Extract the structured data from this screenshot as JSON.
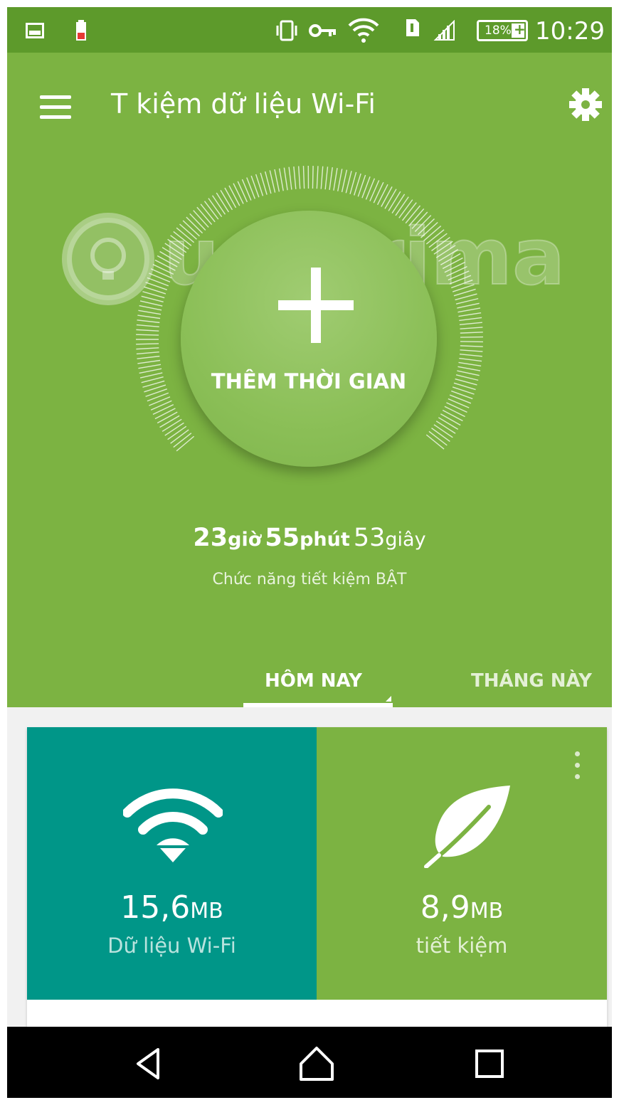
{
  "status_bar": {
    "time": "10:29",
    "battery_percent": "18%",
    "icons": [
      "gallery-icon",
      "battery-low-icon",
      "vibrate-icon",
      "key-icon",
      "wifi-icon",
      "sim-icon",
      "signal-icon"
    ]
  },
  "app_bar": {
    "title": "T kiệm dữ liệu Wi-Fi",
    "menu_icon": "menu-icon",
    "settings_icon": "gear-icon"
  },
  "hero": {
    "add_time_label": "THÊM THỜI GIAN",
    "timer": {
      "hours": "23",
      "hours_unit": "giờ",
      "minutes": "55",
      "minutes_unit": "phút",
      "seconds": "53",
      "seconds_unit": "giây"
    },
    "status": "Chức năng tiết kiệm BẬT"
  },
  "tabs": [
    {
      "label": "HÔM NAY",
      "active": true
    },
    {
      "label": "THÁNG NÀY",
      "active": false
    }
  ],
  "cards": {
    "wifi": {
      "value": "15,6",
      "unit": "MB",
      "label": "Dữ liệu Wi-Fi",
      "color": "#009688"
    },
    "saved": {
      "value": "8,9",
      "unit": "MB",
      "label": "tiết kiệm",
      "color": "#7cb342"
    }
  },
  "watermark": "uantrimang",
  "colors": {
    "primary": "#7cb342",
    "status_bar": "#5d9a2b",
    "teal": "#009688"
  }
}
